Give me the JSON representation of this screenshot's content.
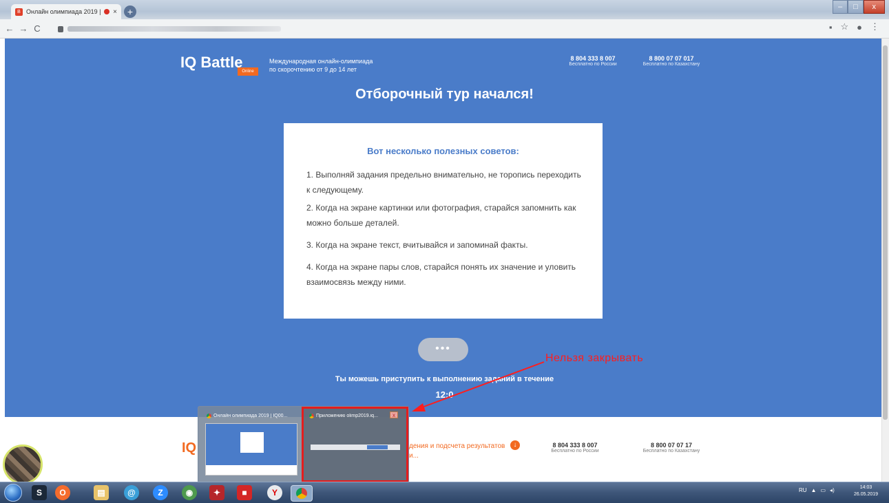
{
  "browser": {
    "tab_title": "Онлайн олимпиада 2019 |",
    "tab_favicon_text": "B",
    "tab_close": "×",
    "new_tab": "+",
    "back": "←",
    "forward": "→",
    "reload": "C",
    "star": "☆",
    "menu": "⋮",
    "window_minimize": "–",
    "window_maximize": "□",
    "window_close": "x"
  },
  "header": {
    "logo": "IQ Battle",
    "logo_badge": "Online",
    "tagline_line1": "Международная онлайн-олимпиада",
    "tagline_line2": "по скорочтению от 9 до 14 лет",
    "phone1_number": "8 804 333 8 007",
    "phone1_caption": "Бесплатно по России",
    "phone2_number": "8 800 07 07 017",
    "phone2_caption": "Бесплатно по Казахстану"
  },
  "main": {
    "headline": "Отборочный тур начался!",
    "card_title": "Вот несколько полезных советов:",
    "tips": [
      "1. Выполняй задания предельно внимательно, не торопись переходить к следующему.",
      "2. Когда на экране картинки или фотография, старайся запомнить как можно больше деталей.",
      "3. Когда на экране текст, вчитывайся и запоминай факты.",
      "4. Когда на экране пары слов, старайся понять их значение и уловить взаимосвязь между ними."
    ],
    "loader": "•••",
    "countdown_text": "Ты можешь приступить к выполнению заданий в течение",
    "timer": "12:0"
  },
  "annotation": {
    "label": "Нельзя закрывать",
    "color": "#ff1d1d"
  },
  "footer": {
    "text_line1": "дения и подсчета результатов",
    "text_line2": "и...",
    "phone1_number": "8 804 333 8 007",
    "phone1_caption": "Бесплатно по России",
    "phone2_number": "8 800 07 07 17",
    "phone2_caption": "Бесплатно по Казахстану"
  },
  "thumbnails": {
    "thumb1_title": "Онлайн олимпиада 2019 | IQ00...",
    "thumb2_title": "Приложению olimp2019.iq...",
    "close": "x"
  },
  "taskbar": {
    "language": "RU",
    "time": "14:03",
    "date": "26.05.2019",
    "icons": [
      "steam-icon",
      "origin-icon",
      "explorer-icon",
      "browser-icon",
      "zoom-icon",
      "app-icon",
      "app-icon-2",
      "app-icon-3",
      "yandex-icon",
      "chrome-icon"
    ]
  },
  "colors": {
    "page_bg": "#4a7cc9",
    "accent": "#f26a21",
    "card_title": "#4a7cc9"
  }
}
